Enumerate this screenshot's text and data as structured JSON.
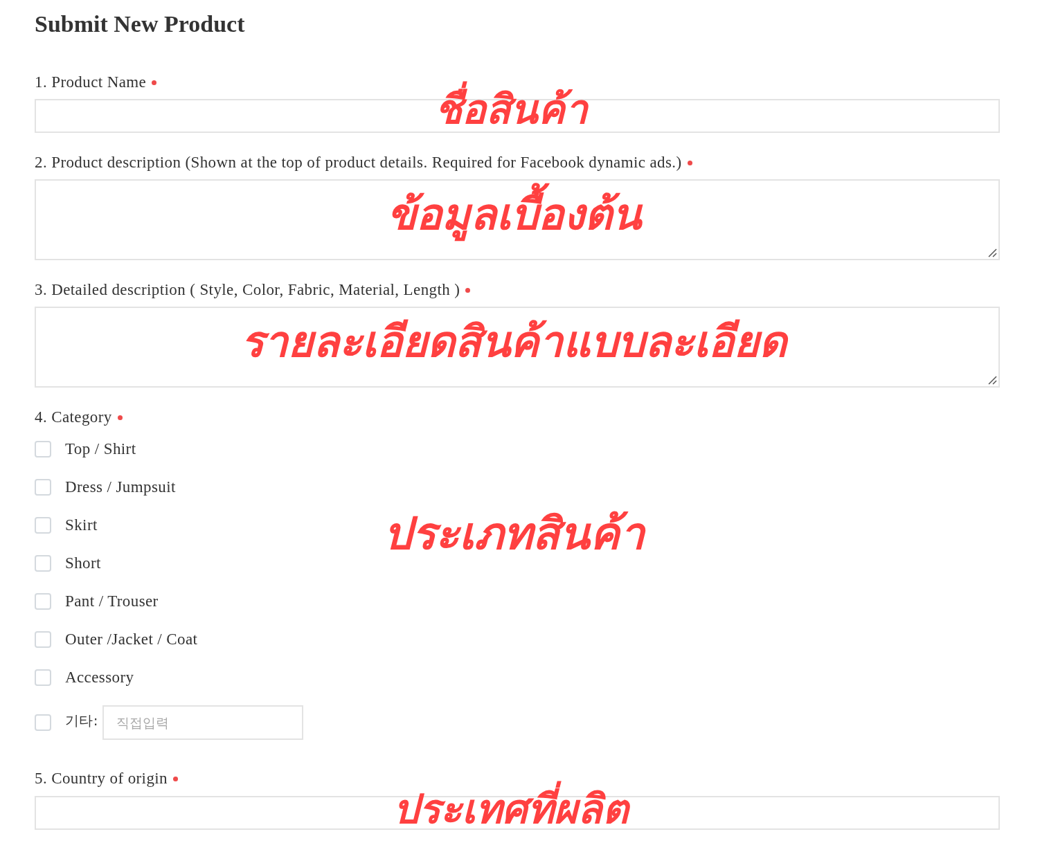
{
  "title": "Submit New Product",
  "fields": [
    {
      "kind": "text",
      "label": "1. Product Name",
      "required": true,
      "annotation": "ชื่อสินค้า"
    },
    {
      "kind": "textarea",
      "label": "2. Product description (Shown at the top of product details. Required for Facebook dynamic ads.)",
      "required": true,
      "annotation": "ข้อมูลเบื้องต้น"
    },
    {
      "kind": "textarea",
      "label": "3. Detailed description ( Style, Color, Fabric, Material, Length )",
      "required": true,
      "annotation": "รายละเอียดสินค้าแบบละเอียด"
    },
    {
      "kind": "checkboxes",
      "label": "4. Category",
      "required": true,
      "annotation": "ประเภทสินค้า",
      "options": [
        {
          "kind": "plain",
          "label": "Top / Shirt",
          "checked": false
        },
        {
          "kind": "plain",
          "label": "Dress / Jumpsuit",
          "checked": false
        },
        {
          "kind": "plain",
          "label": "Skirt",
          "checked": false
        },
        {
          "kind": "plain",
          "label": "Short",
          "checked": false
        },
        {
          "kind": "plain",
          "label": "Pant / Trouser",
          "checked": false
        },
        {
          "kind": "plain",
          "label": "Outer /Jacket / Coat",
          "checked": false
        },
        {
          "kind": "plain",
          "label": "Accessory",
          "checked": false
        },
        {
          "kind": "other",
          "label": "기타:",
          "checked": false,
          "placeholder": "직접입력"
        }
      ]
    },
    {
      "kind": "text",
      "label": "5. Country of origin",
      "required": true,
      "annotation": "ประเทศที่ผลิต"
    }
  ]
}
